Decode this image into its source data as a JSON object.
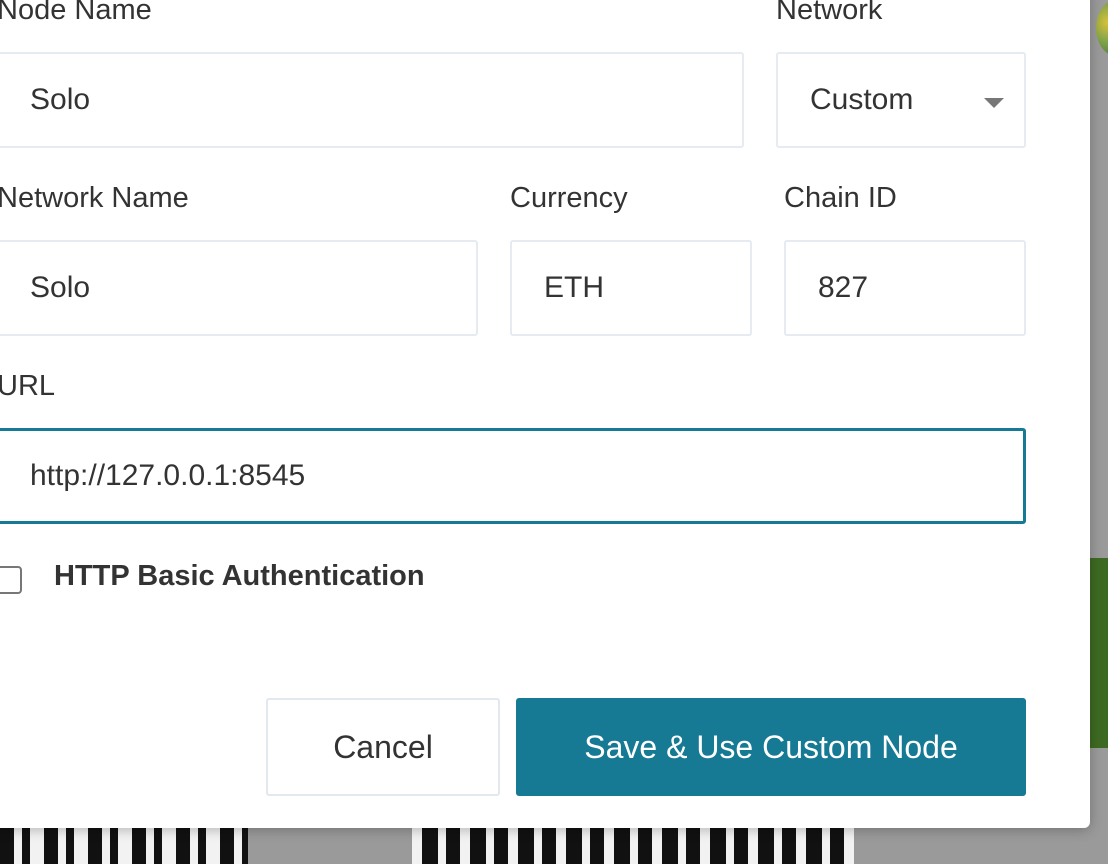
{
  "modal": {
    "node_name": {
      "label": "Node Name",
      "value": "Solo"
    },
    "network": {
      "label": "Network",
      "selected": "Custom"
    },
    "network_name": {
      "label": "Network Name",
      "value": "Solo"
    },
    "currency": {
      "label": "Currency",
      "value": "ETH"
    },
    "chain_id": {
      "label": "Chain ID",
      "value": "827"
    },
    "url": {
      "label": "URL",
      "value": "http://127.0.0.1:8545"
    },
    "http_auth": {
      "label": "HTTP Basic Authentication",
      "checked": false
    },
    "buttons": {
      "cancel": "Cancel",
      "save": "Save & Use Custom Node"
    }
  },
  "colors": {
    "accent": "#167a95",
    "border": "#e6ebf1",
    "text": "#333333"
  }
}
